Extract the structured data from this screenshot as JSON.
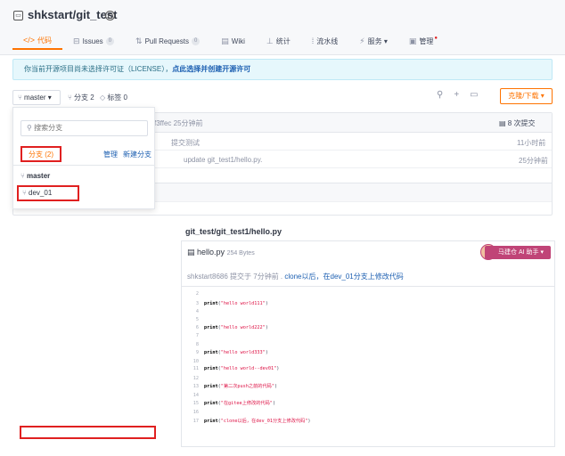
{
  "repo": {
    "title": "shkstart/git_test"
  },
  "tabs": [
    {
      "icon": "</>",
      "label": "代码",
      "count": "",
      "active": true
    },
    {
      "icon": "⊟",
      "label": "Issues",
      "count": "0",
      "active": false
    },
    {
      "icon": "⇅",
      "label": "Pull Requests",
      "count": "0",
      "active": false
    },
    {
      "icon": "▤",
      "label": "Wiki",
      "count": "",
      "active": false
    },
    {
      "icon": "⊥",
      "label": "统计",
      "count": "",
      "active": false
    },
    {
      "icon": "⁞",
      "label": "流水线",
      "count": "",
      "active": false
    },
    {
      "icon": "⚡",
      "label": "服务 ▾",
      "count": "",
      "active": false
    },
    {
      "icon": "▣",
      "label": "管理",
      "count": "",
      "active": false
    }
  ],
  "notice": {
    "text": "你当前开源项目尚未选择许可证（LICENSE），",
    "link": "点此选择并创建开源许可"
  },
  "branch_bar": {
    "current": "master ▾",
    "branches": "分支 2",
    "tags": "标签 0",
    "clone": "克隆/下载 ▾"
  },
  "table": {
    "head_commit": "f3ffec  25分钟前",
    "commit_count": "8 次提交",
    "rows": [
      {
        "message": "提交测试",
        "time": "11小时前"
      },
      {
        "message": "update git_test1/hello.py.",
        "time": "25分钟前"
      }
    ]
  },
  "dropdown": {
    "search_placeholder": "搜索分支",
    "branch_tab": "分支 (2)",
    "manage": "管理",
    "new_branch": "新建分支",
    "master": "master",
    "dev": "dev_01"
  },
  "file": {
    "path": "git_test/git_test1/hello.py",
    "name": "hello.py",
    "size": "254 Bytes",
    "commit_prefix": "shkstart8686 提交于 7分钟前 . ",
    "commit_msg": "clone以后，在dev_01分支上修改代码",
    "ai_button": "马建仓 AI 助手 ▾"
  },
  "code_lines": [
    {
      "n": "2",
      "code": ""
    },
    {
      "n": "3",
      "code": "print(\"hello world111\")"
    },
    {
      "n": "4",
      "code": ""
    },
    {
      "n": "5",
      "code": ""
    },
    {
      "n": "6",
      "code": "print(\"hello world222\")"
    },
    {
      "n": "7",
      "code": ""
    },
    {
      "n": "8",
      "code": ""
    },
    {
      "n": "9",
      "code": "print(\"hello world333\")"
    },
    {
      "n": "10",
      "code": ""
    },
    {
      "n": "11",
      "code": "print(\"hello world--dev01\")"
    },
    {
      "n": "12",
      "code": ""
    },
    {
      "n": "13",
      "code": "print(\"第二次push之前的代码\")"
    },
    {
      "n": "14",
      "code": ""
    },
    {
      "n": "15",
      "code": "print(\"在gitee上修改的代码\")"
    },
    {
      "n": "16",
      "code": ""
    },
    {
      "n": "17",
      "code": "print(\"clone以后，在dev_01分支上修改代码\")"
    }
  ],
  "colors": {
    "accent": "#fe7300",
    "highlight": "#e02020",
    "link": "#1c5fb1"
  }
}
